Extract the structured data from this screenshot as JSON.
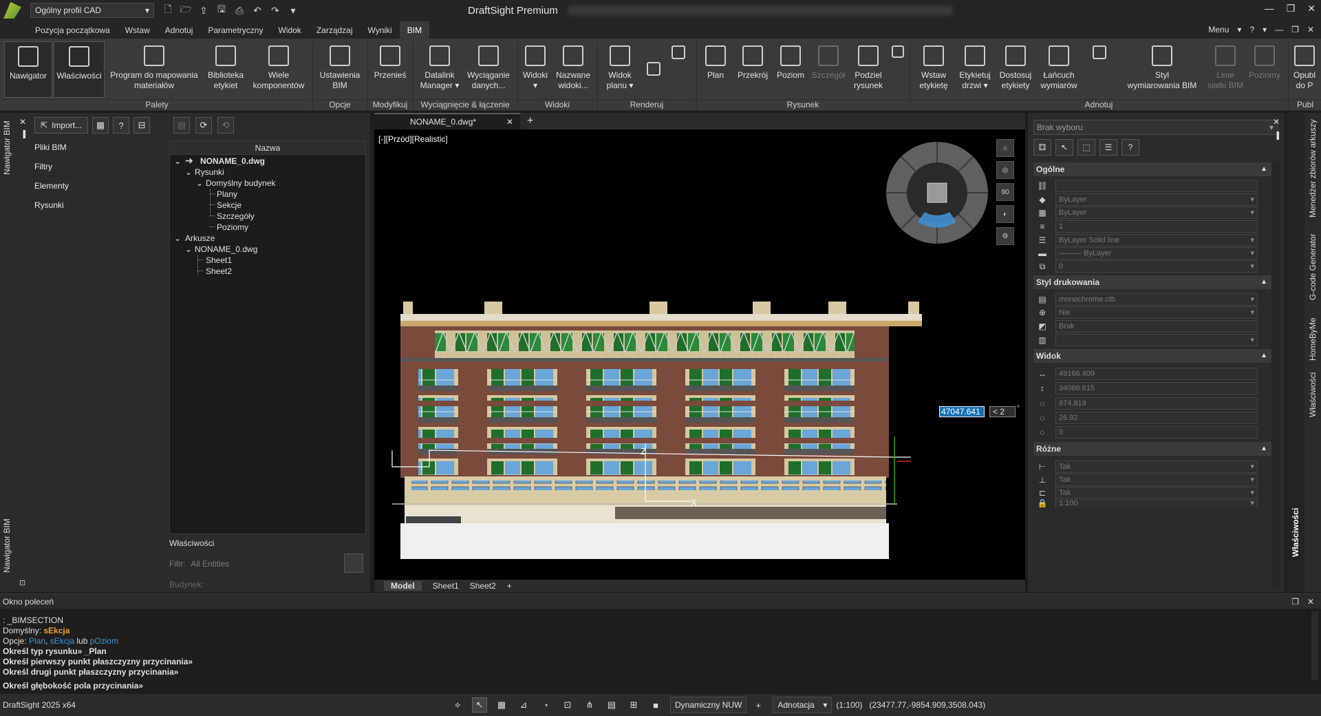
{
  "titlebar": {
    "profile": "Ogólny profil CAD",
    "title": "DraftSight Premium",
    "quick_icons": [
      "new-file-icon",
      "open-file-icon",
      "open-folder-icon",
      "save-icon",
      "print-icon",
      "undo-icon",
      "redo-icon",
      "customize-icon"
    ]
  },
  "menubar": {
    "tabs": [
      "Pozycja początkowa",
      "Wstaw",
      "Adnotuj",
      "Parametryczny",
      "Widok",
      "Zarządzaj",
      "Wyniki",
      "BIM"
    ],
    "active_tab": "BIM",
    "right_menu": "Menu",
    "help": "?"
  },
  "ribbon": {
    "buttons": {
      "nawigator": "Nawigator",
      "wlasciwosci": "Właściwości",
      "program": "Program do mapowania\nmateriałów",
      "biblioteka": "Biblioteka\netykiet",
      "wiele": "Wiele\nkomponentów",
      "ustawienia": "Ustawienia\nBIM",
      "przenies": "Przenieś",
      "datalink": "Datalink\nManager ▾",
      "wyciaganie": "Wyciąganie\ndanych...",
      "widoki": "Widoki\n▾",
      "nazwane": "Nazwane\nwidoki...",
      "widok_planu": "Widok\nplanu ▾",
      "plan": "Plan",
      "przekroj": "Przekrój",
      "poziom": "Poziom",
      "szczegol": "Szczegół",
      "podziel": "Podziel\nrysunek",
      "wstaw_etykiete": "Wstaw\netykietę",
      "etykietuj_drzwi": "Etykietuj\ndrzwi ▾",
      "dostosuj": "Dostosuj\netykiety",
      "lancuch": "Łańcuch\nwymiarów",
      "styl": "Styl\nwymiarowania BIM",
      "linie": "Linie\nsiatki BIM",
      "poziomy": "Poziomy",
      "opublikuj": "Opubl\ndo P"
    },
    "groups": {
      "palety": "Palety",
      "opcje": "Opcje",
      "modyfikuj": "Modyfikuj",
      "wyciagniecie": "Wyciągnięcie & łączenie",
      "widoki": "Widoki",
      "renderuj": "Renderuj",
      "rysunek": "Rysunek",
      "adnotuj": "Adnotuj",
      "publ": "Publ"
    }
  },
  "left_strip": {
    "label_top": "Nawigator BIM",
    "label_bottom": "Nawigator BIM"
  },
  "bim_nav": {
    "import_label": "Import...",
    "help": "?",
    "categories": [
      "Pliki BIM",
      "Filtry",
      "Elementy",
      "Rysunki"
    ]
  },
  "tree": {
    "header": "Nazwa",
    "root": "NONAME_0.dwg",
    "rysunki": "Rysunki",
    "budynek": "Domyślny budynek",
    "plany": "Plany",
    "sekcje": "Sekcje",
    "szczegoly": "Szczegóły",
    "poziomy": "Poziomy",
    "arkusze": "Arkusze",
    "arkusze_file": "NONAME_0.dwg",
    "sheet1": "Sheet1",
    "sheet2": "Sheet2",
    "props_title": "Właściwości",
    "filter_label": "Filtr:",
    "filter_value": "All Entities",
    "building_label": "Budynek:"
  },
  "document": {
    "tab": "NONAME_0.dwg*",
    "view_label": "[-][Przód][Realistic]",
    "dim_value": "47047.641",
    "angle_value": "< 2",
    "angle_unit": "°",
    "nav_value": "90",
    "model_tabs": [
      "Model",
      "Sheet1",
      "Sheet2"
    ]
  },
  "properties": {
    "selection": "Brak wyboru",
    "sections": {
      "ogolne": "Ogólne",
      "styl": "Styl drukowania",
      "widok": "Widok",
      "rozne": "Różne"
    },
    "ogolne_rows": [
      "",
      "ByLayer",
      "ByLayer",
      "1",
      "ByLayer     Solid line",
      "——— ByLayer",
      "0"
    ],
    "styl_rows": [
      "monochrome.ctb",
      "Nie",
      "Brak",
      ""
    ],
    "widok_rows": [
      "49166.409",
      "34086.615",
      "674.819",
      "26.92",
      "0"
    ],
    "rozne_rows": [
      "Tak",
      "Tak",
      "Tak",
      "1:100"
    ]
  },
  "right_strip": {
    "tabs": [
      "Menedżer zbiorów arkuszy",
      "G-code Generator",
      "HomeByMe",
      "Właściwości"
    ],
    "active_label": "Właściwości"
  },
  "command": {
    "title": "Okno poleceń",
    "line1": ": _BIMSECTION",
    "line2_label": "Domyślny: ",
    "line2_value": "sEkcja",
    "line3_label": "Opcje: ",
    "opt_plan": "Plan",
    "opt_sep1": ", ",
    "opt_sekcja": "sEkcja",
    "opt_sep2": " lub ",
    "opt_poziom": "pOziom",
    "line4": "Określ typ rysunku» _Plan",
    "line5": "Określ pierwszy punkt płaszczyzny przycinania»",
    "line6": "Określ drugi punkt płaszczyzny przycinania»",
    "line7": "Określ głębokość pola przycinania»"
  },
  "statusbar": {
    "version": "DraftSight 2025 x64",
    "ucs": "Dynamiczny NUW",
    "annotation": "Adnotacja",
    "scale": "(1:100)",
    "coords": "(23477.77,-9854.909,3508.043)"
  },
  "colors": {
    "accent": "#1a6fb5",
    "facade_brick": "#7a4a3c",
    "facade_cream": "#d9c9a0",
    "window_green": "#1f6e2c",
    "glass_blue": "#6aa6d8"
  }
}
